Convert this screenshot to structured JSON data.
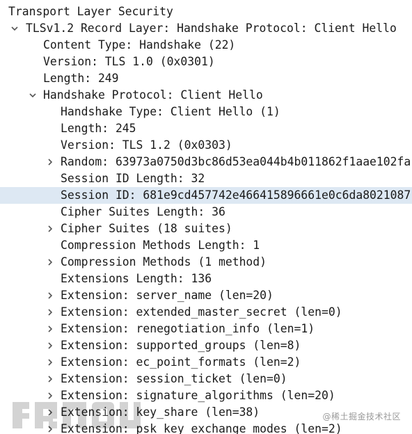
{
  "packet_details": {
    "rows": [
      {
        "text": "Transport Layer Security",
        "depth": 0,
        "toggle": "none",
        "selected": false
      },
      {
        "text": "TLSv1.2 Record Layer: Handshake Protocol: Client Hello",
        "depth": 1,
        "toggle": "expanded",
        "selected": false
      },
      {
        "text": "Content Type: Handshake (22)",
        "depth": 2,
        "toggle": "none",
        "selected": false
      },
      {
        "text": "Version: TLS 1.0 (0x0301)",
        "depth": 2,
        "toggle": "none",
        "selected": false
      },
      {
        "text": "Length: 249",
        "depth": 2,
        "toggle": "none",
        "selected": false
      },
      {
        "text": "Handshake Protocol: Client Hello",
        "depth": 2,
        "toggle": "expanded",
        "selected": false
      },
      {
        "text": "Handshake Type: Client Hello (1)",
        "depth": 3,
        "toggle": "none",
        "selected": false
      },
      {
        "text": "Length: 245",
        "depth": 3,
        "toggle": "none",
        "selected": false
      },
      {
        "text": "Version: TLS 1.2 (0x0303)",
        "depth": 3,
        "toggle": "none",
        "selected": false
      },
      {
        "text": "Random: 63973a0750d3bc86d53ea044b4b011862f1aae102fa",
        "depth": 3,
        "toggle": "collapsed",
        "selected": false
      },
      {
        "text": "Session ID Length: 32",
        "depth": 3,
        "toggle": "none",
        "selected": false
      },
      {
        "text": "Session ID: 681e9cd457742e466415896661e0c6da8021087",
        "depth": 3,
        "toggle": "none",
        "selected": true
      },
      {
        "text": "Cipher Suites Length: 36",
        "depth": 3,
        "toggle": "none",
        "selected": false
      },
      {
        "text": "Cipher Suites (18 suites)",
        "depth": 3,
        "toggle": "collapsed",
        "selected": false
      },
      {
        "text": "Compression Methods Length: 1",
        "depth": 3,
        "toggle": "none",
        "selected": false
      },
      {
        "text": "Compression Methods (1 method)",
        "depth": 3,
        "toggle": "collapsed",
        "selected": false
      },
      {
        "text": "Extensions Length: 136",
        "depth": 3,
        "toggle": "none",
        "selected": false
      },
      {
        "text": "Extension: server_name (len=20)",
        "depth": 3,
        "toggle": "collapsed",
        "selected": false
      },
      {
        "text": "Extension: extended_master_secret (len=0)",
        "depth": 3,
        "toggle": "collapsed",
        "selected": false
      },
      {
        "text": "Extension: renegotiation_info (len=1)",
        "depth": 3,
        "toggle": "collapsed",
        "selected": false
      },
      {
        "text": "Extension: supported_groups (len=8)",
        "depth": 3,
        "toggle": "collapsed",
        "selected": false
      },
      {
        "text": "Extension: ec_point_formats (len=2)",
        "depth": 3,
        "toggle": "collapsed",
        "selected": false
      },
      {
        "text": "Extension: session_ticket (len=0)",
        "depth": 3,
        "toggle": "collapsed",
        "selected": false
      },
      {
        "text": "Extension: signature_algorithms (len=20)",
        "depth": 3,
        "toggle": "collapsed",
        "selected": false
      },
      {
        "text": "Extension: key_share (len=38)",
        "depth": 3,
        "toggle": "collapsed",
        "selected": false
      },
      {
        "text": "Extension: psk_key_exchange_modes (len=2)",
        "depth": 3,
        "toggle": "collapsed",
        "selected": false
      }
    ]
  },
  "watermark": {
    "text": "@稀土掘金技术社区"
  },
  "colors": {
    "selected_row": "#dde8f3",
    "text": "#1a1a1a",
    "toggle": "#555555"
  }
}
